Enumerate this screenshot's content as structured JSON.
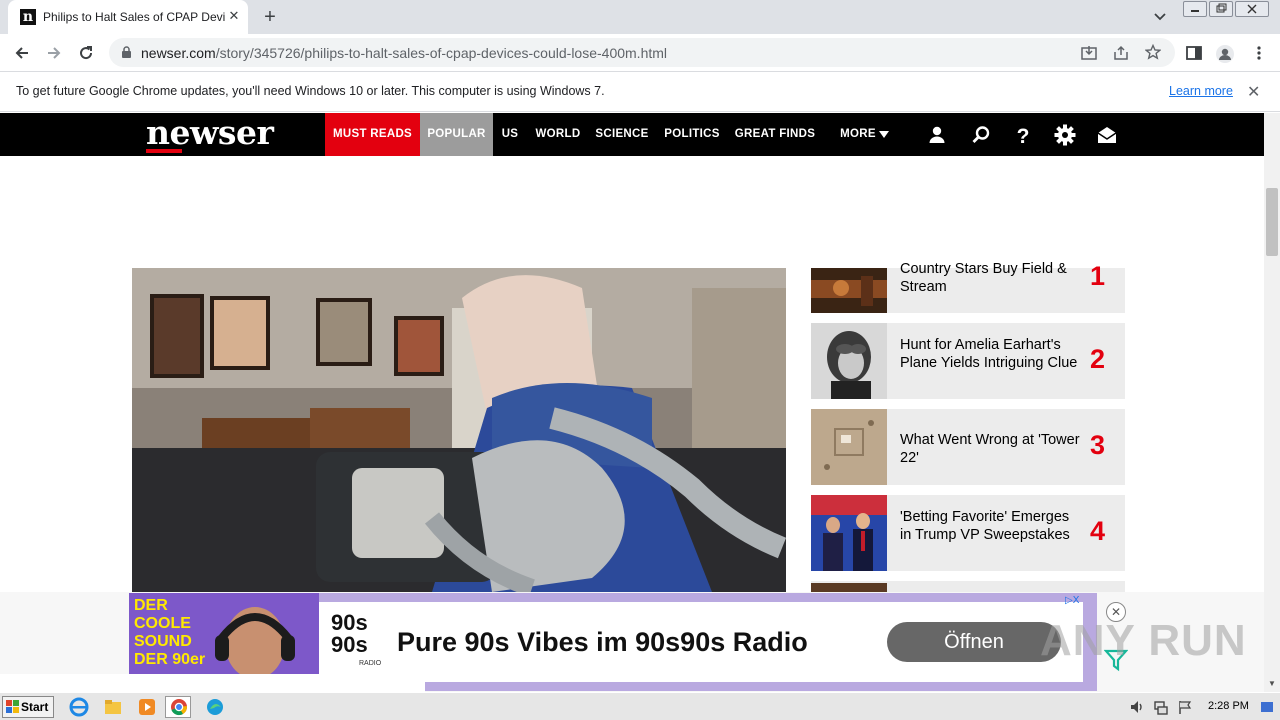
{
  "browser": {
    "tab_title": "Philips to Halt Sales of CPAP Devices",
    "favicon_letter": "n",
    "url_host": "newser.com",
    "url_path": "/story/345726/philips-to-halt-sales-of-cpap-devices-could-lose-400m.html"
  },
  "infobar": {
    "message": "To get future Google Chrome updates, you'll need Windows 10 or later. This computer is using Windows 7.",
    "link": "Learn more"
  },
  "site": {
    "logo": "newser",
    "nav": [
      "MUST READS",
      "POPULAR",
      "US",
      "WORLD",
      "SCIENCE",
      "POLITICS",
      "GREAT FINDS",
      "MORE"
    ],
    "icons": [
      "user-icon",
      "search-icon",
      "help-icon",
      "settings-icon",
      "mail-icon"
    ],
    "accent": "#e3000f"
  },
  "popular": [
    {
      "title": "Country Stars Buy Field & Stream",
      "rank": "1"
    },
    {
      "title": "Hunt for Amelia Earhart's Plane Yields Intriguing Clue",
      "rank": "2"
    },
    {
      "title": "What Went Wrong at 'Tower 22'",
      "rank": "3"
    },
    {
      "title": "'Betting Favorite' Emerges in Trump VP Sweepstakes",
      "rank": "4"
    }
  ],
  "ad": {
    "left_headline": "DER COOLE SOUND DER 90er",
    "logo_text": "90s 90s",
    "logo_sub": "RADIO",
    "headline": "Pure 90s Vibes im 90s90s Radio",
    "cta": "Öffnen",
    "badge": "▷X"
  },
  "watermark": "ANY RUN",
  "taskbar": {
    "start": "Start",
    "clock": "2:28 PM"
  }
}
